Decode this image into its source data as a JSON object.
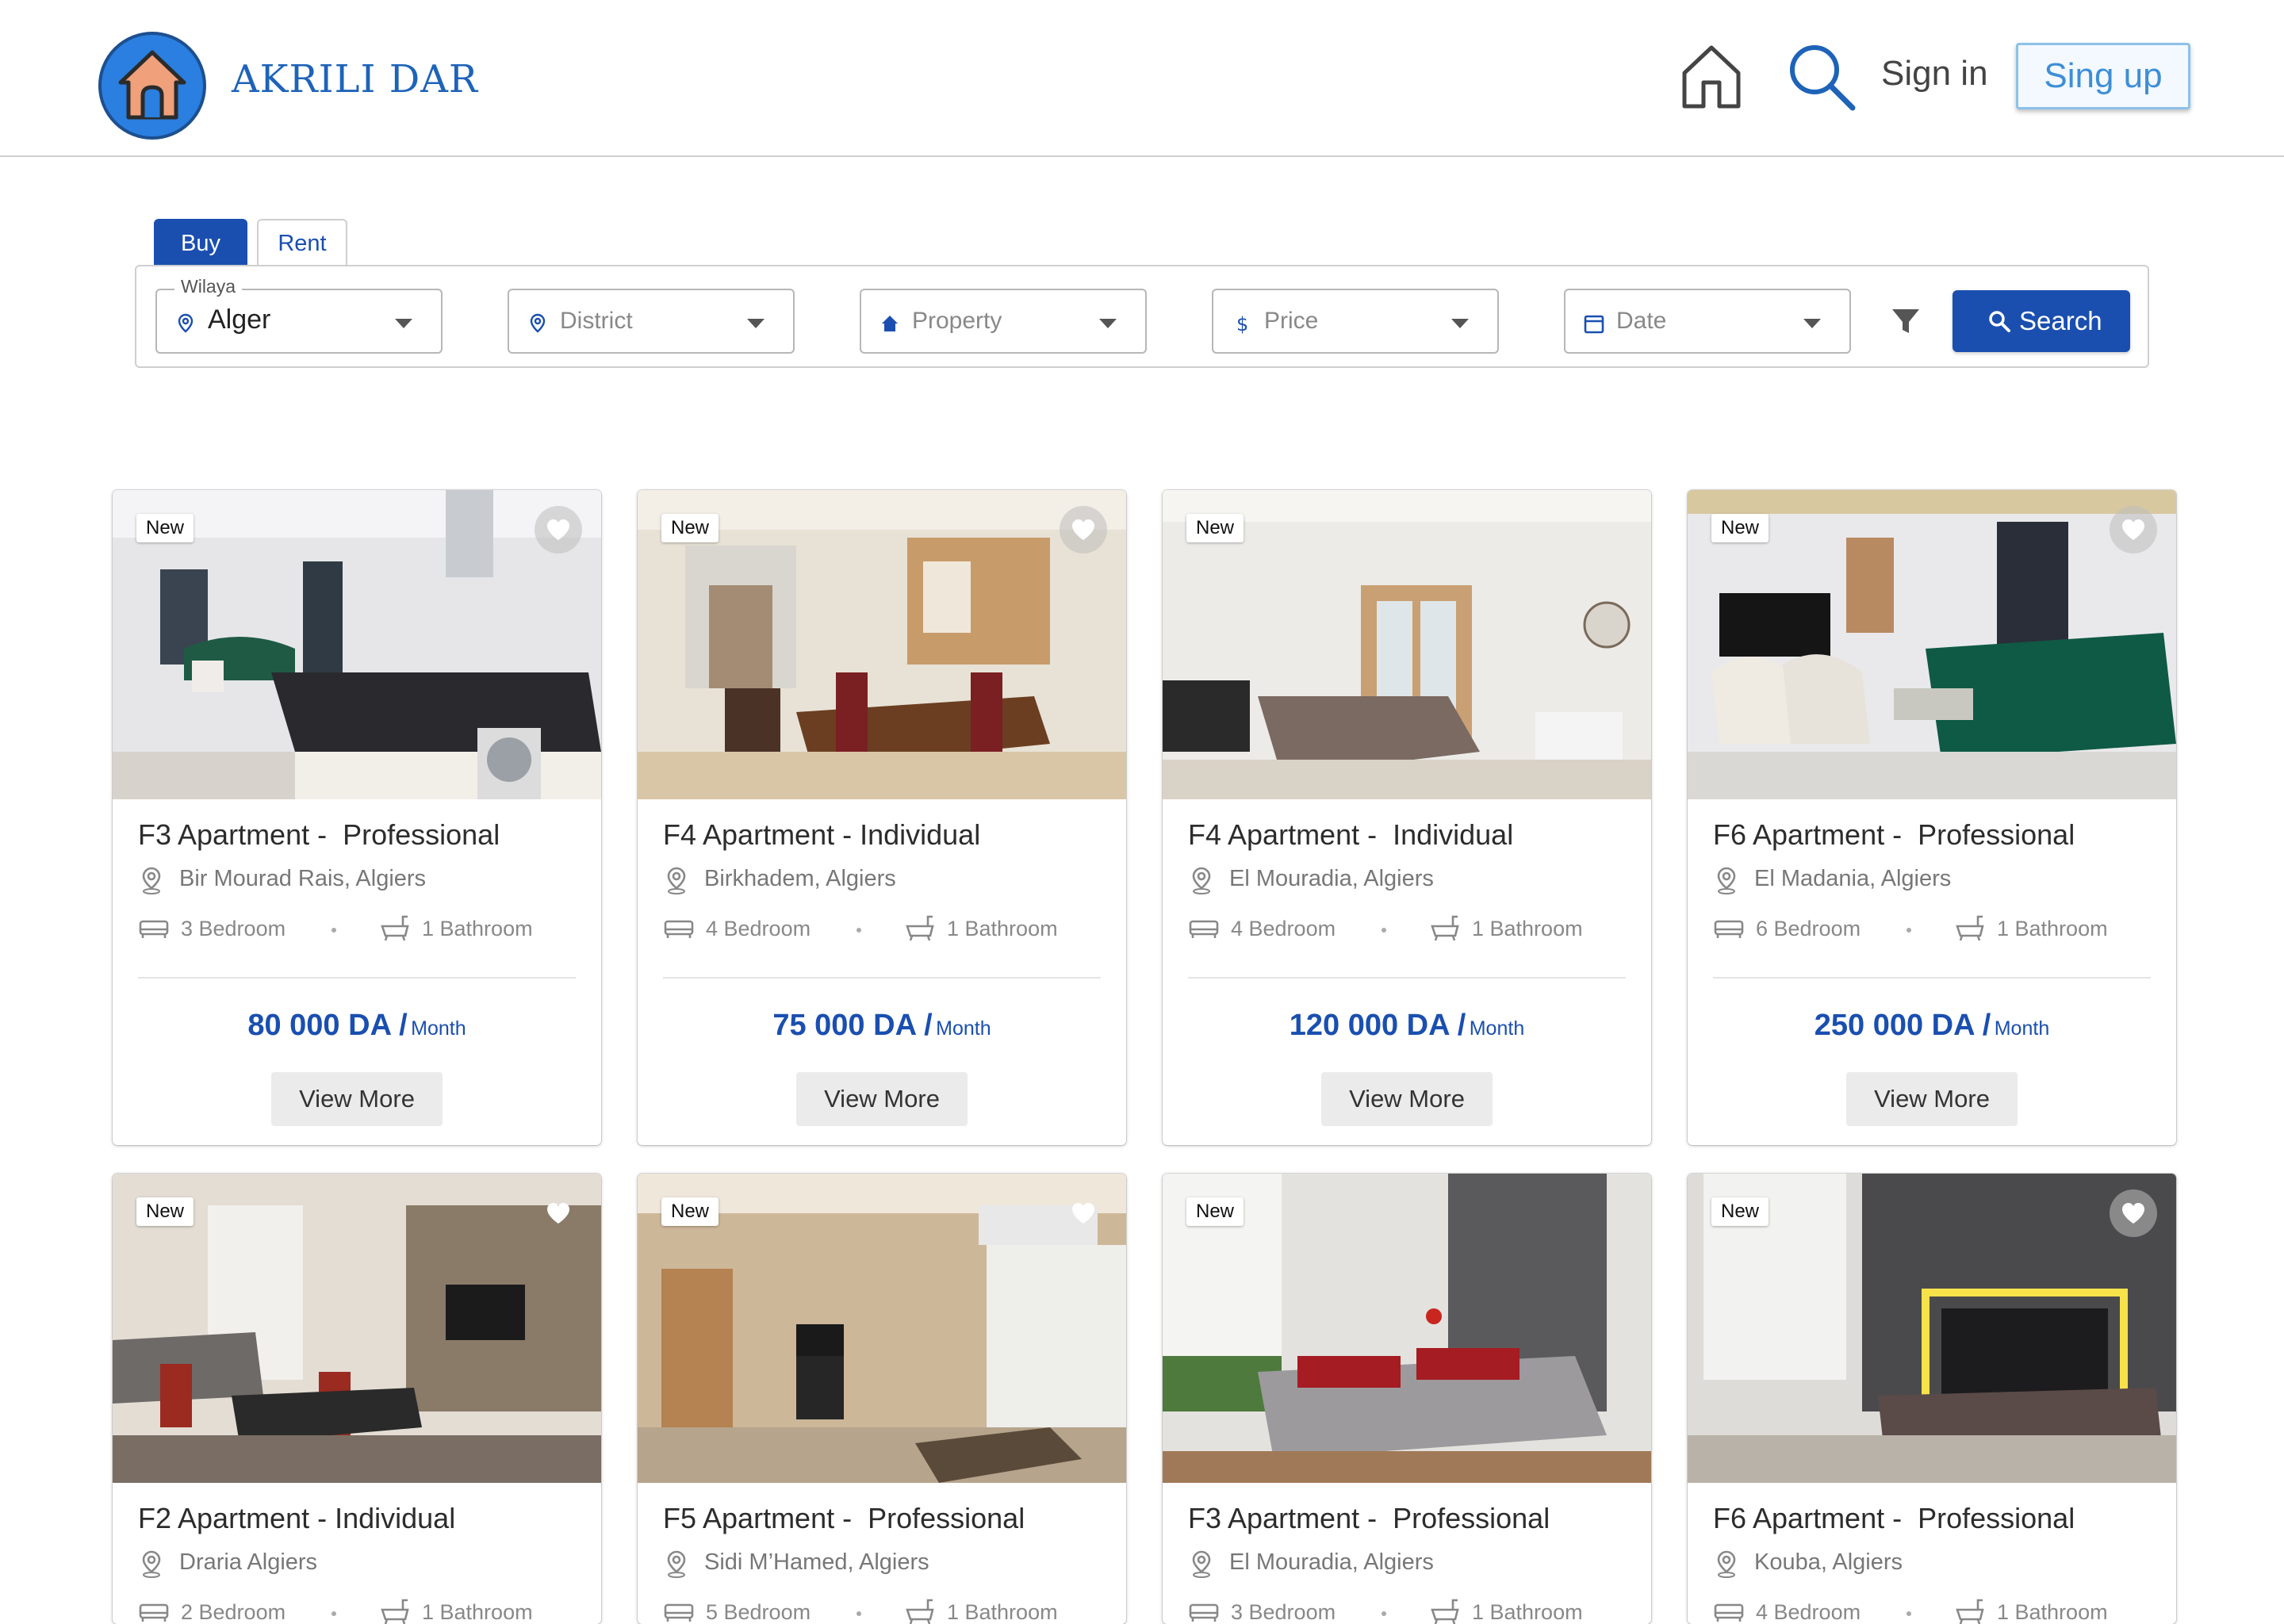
{
  "header": {
    "brand": "AKRILI DAR",
    "sign_in": "Sign in",
    "sign_up": "Sing up",
    "icons": [
      "home-icon",
      "search-icon"
    ]
  },
  "search": {
    "tabs": [
      "Buy",
      "Rent"
    ],
    "active_tab": "Buy",
    "fields": {
      "wilaya": {
        "label": "Wilaya",
        "value": "Alger"
      },
      "district": {
        "placeholder": "District"
      },
      "property": {
        "placeholder": "Property"
      },
      "price": {
        "placeholder": "Price"
      },
      "date": {
        "placeholder": "Date"
      }
    },
    "search_button": "Search"
  },
  "listings": [
    {
      "badge": "New",
      "title": "F3 Apartment -  Professional",
      "location": "Bir Mourad Rais, Algiers",
      "bedrooms": "3 Bedroom",
      "bathrooms": "1 Bathroom",
      "price": "80 000 DA /",
      "unit": "Month",
      "button": "View More"
    },
    {
      "badge": "New",
      "title": "F4 Apartment - Individual",
      "location": "Birkhadem, Algiers",
      "bedrooms": "4 Bedroom",
      "bathrooms": "1 Bathroom",
      "price": "75 000 DA /",
      "unit": "Month",
      "button": "View More"
    },
    {
      "badge": "New",
      "title": "F4 Apartment -  Individual",
      "location": "El Mouradia, Algiers",
      "bedrooms": "4 Bedroom",
      "bathrooms": "1 Bathroom",
      "price": "120 000 DA /",
      "unit": "Month",
      "button": "View More"
    },
    {
      "badge": "New",
      "title": "F6 Apartment -  Professional",
      "location": "El Madania, Algiers",
      "bedrooms": "6 Bedroom",
      "bathrooms": "1 Bathroom",
      "price": "250 000 DA /",
      "unit": "Month",
      "button": "View More"
    },
    {
      "badge": "New",
      "title": "F2 Apartment - Individual",
      "location": "Draria Algiers",
      "bedrooms": "2 Bedroom",
      "bathrooms": "1 Bathroom"
    },
    {
      "badge": "New",
      "title": "F5 Apartment -  Professional",
      "location": "Sidi M’Hamed, Algiers",
      "bedrooms": "5 Bedroom",
      "bathrooms": "1 Bathroom"
    },
    {
      "badge": "New",
      "title": "F3 Apartment -  Professional",
      "location": "El Mouradia, Algiers",
      "bedrooms": "3 Bedroom",
      "bathrooms": "1 Bathroom"
    },
    {
      "badge": "New",
      "title": "F6 Apartment -  Professional",
      "location": "Kouba, Algiers",
      "bedrooms": "4 Bedroom",
      "bathrooms": "1 Bathroom"
    }
  ],
  "colors": {
    "accent": "#1a4fb0",
    "brand": "#1e63b8",
    "signup_border": "#8cc1ea"
  }
}
